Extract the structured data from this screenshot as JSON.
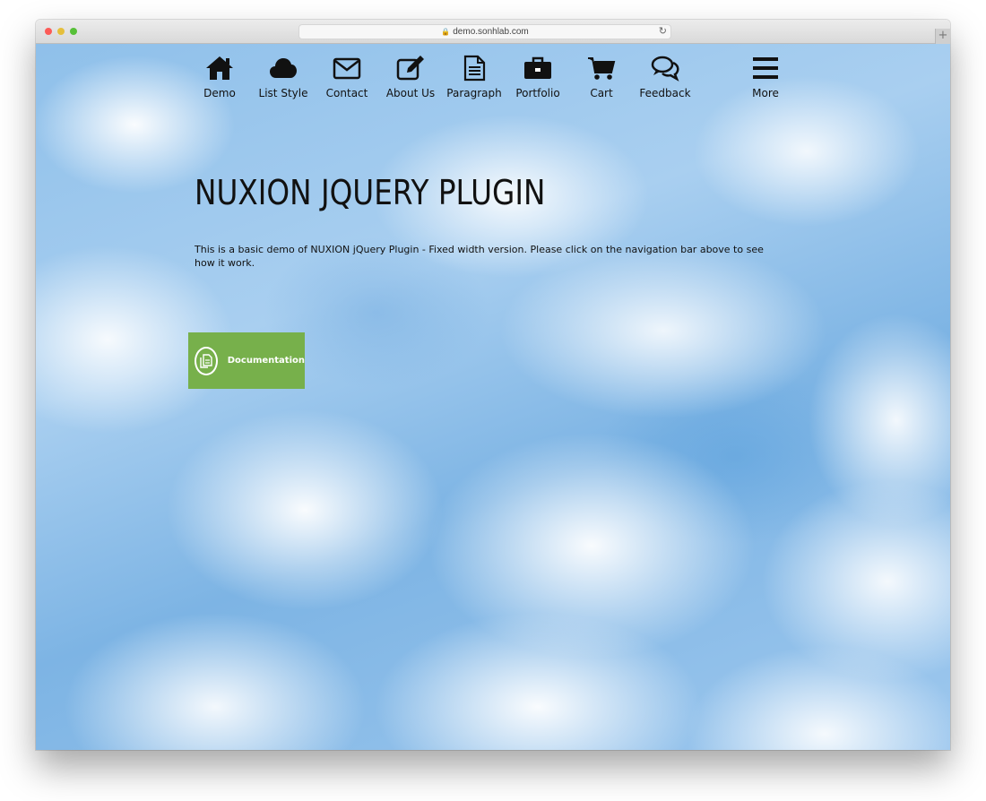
{
  "browser": {
    "url": "demo.sonhlab.com",
    "newtab_symbol": "+"
  },
  "nav": {
    "items": [
      {
        "label": "Demo",
        "icon": "home-icon"
      },
      {
        "label": "List Style",
        "icon": "cloud-icon"
      },
      {
        "label": "Contact",
        "icon": "envelope-icon"
      },
      {
        "label": "About Us",
        "icon": "edit-icon"
      },
      {
        "label": "Paragraph",
        "icon": "document-icon"
      },
      {
        "label": "Portfolio",
        "icon": "briefcase-icon"
      },
      {
        "label": "Cart",
        "icon": "cart-icon"
      },
      {
        "label": "Feedback",
        "icon": "chat-icon"
      },
      {
        "label": "More",
        "icon": "menu-icon"
      }
    ]
  },
  "main": {
    "title": "NUXION JQUERY PLUGIN",
    "intro": "This is a basic demo of NUXION jQuery Plugin - Fixed width version. Please click on the navigation bar above to see how it work.",
    "doc_button": {
      "label": "Documentation",
      "icon": "documents-icon"
    }
  },
  "colors": {
    "doc_button_bg": "#77b04b",
    "sky": "#8fc0ea",
    "nav_text": "#111111"
  }
}
